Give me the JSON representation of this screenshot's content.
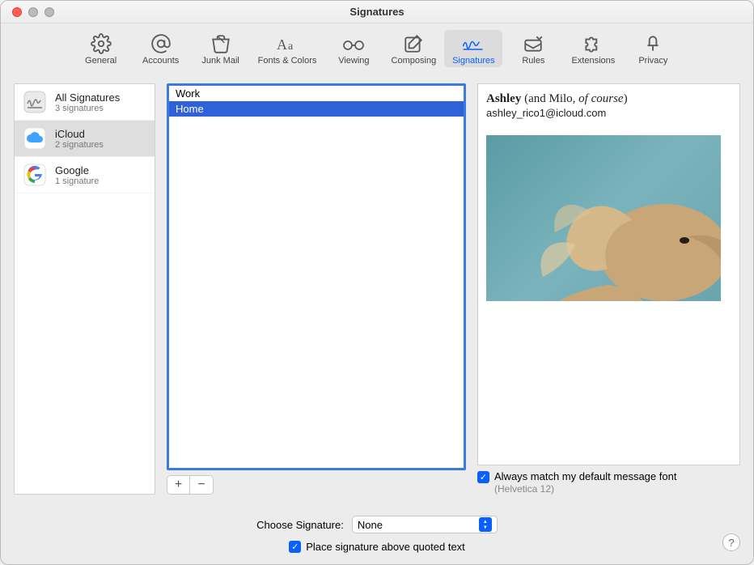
{
  "window": {
    "title": "Signatures"
  },
  "toolbar": {
    "items": [
      {
        "label": "General"
      },
      {
        "label": "Accounts"
      },
      {
        "label": "Junk Mail"
      },
      {
        "label": "Fonts & Colors"
      },
      {
        "label": "Viewing"
      },
      {
        "label": "Composing"
      },
      {
        "label": "Signatures"
      },
      {
        "label": "Rules"
      },
      {
        "label": "Extensions"
      },
      {
        "label": "Privacy"
      }
    ]
  },
  "accounts": {
    "items": [
      {
        "title": "All Signatures",
        "sub": "3 signatures"
      },
      {
        "title": "iCloud",
        "sub": "2 signatures"
      },
      {
        "title": "Google",
        "sub": "1 signature"
      }
    ]
  },
  "signatures": {
    "items": [
      {
        "name": "Work"
      },
      {
        "name": "Home"
      }
    ]
  },
  "buttons": {
    "add": "+",
    "remove": "−"
  },
  "preview": {
    "name_bold": "Ashley",
    "name_rest": " (and Milo, ",
    "name_italic": "of course",
    "name_close": ")",
    "email": "ashley_rico1@icloud.com"
  },
  "options": {
    "match_font_label": "Always match my default message font",
    "match_font_sub": "(Helvetica 12)",
    "choose_label": "Choose Signature:",
    "choose_value": "None",
    "place_above_label": "Place signature above quoted text",
    "help": "?"
  }
}
